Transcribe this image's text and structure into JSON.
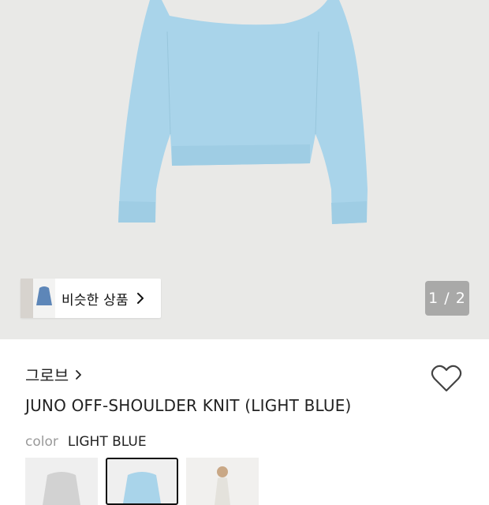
{
  "gallery": {
    "similar_label": "비슷한 상품",
    "pager": "1 / 2",
    "product_color": "#a9d4ea"
  },
  "product": {
    "brand": "그로브",
    "name": "JUNO OFF-SHOULDER KNIT (LIGHT BLUE)",
    "color_key": "color",
    "color_value": "LIGHT BLUE",
    "options": [
      {
        "name": "gray"
      },
      {
        "name": "light-blue",
        "selected": true
      },
      {
        "name": "model-photo"
      }
    ]
  },
  "icons": {
    "wishlist": "heart-icon",
    "brand_link": "chevron-right-icon",
    "similar": "chevron-right-icon"
  }
}
